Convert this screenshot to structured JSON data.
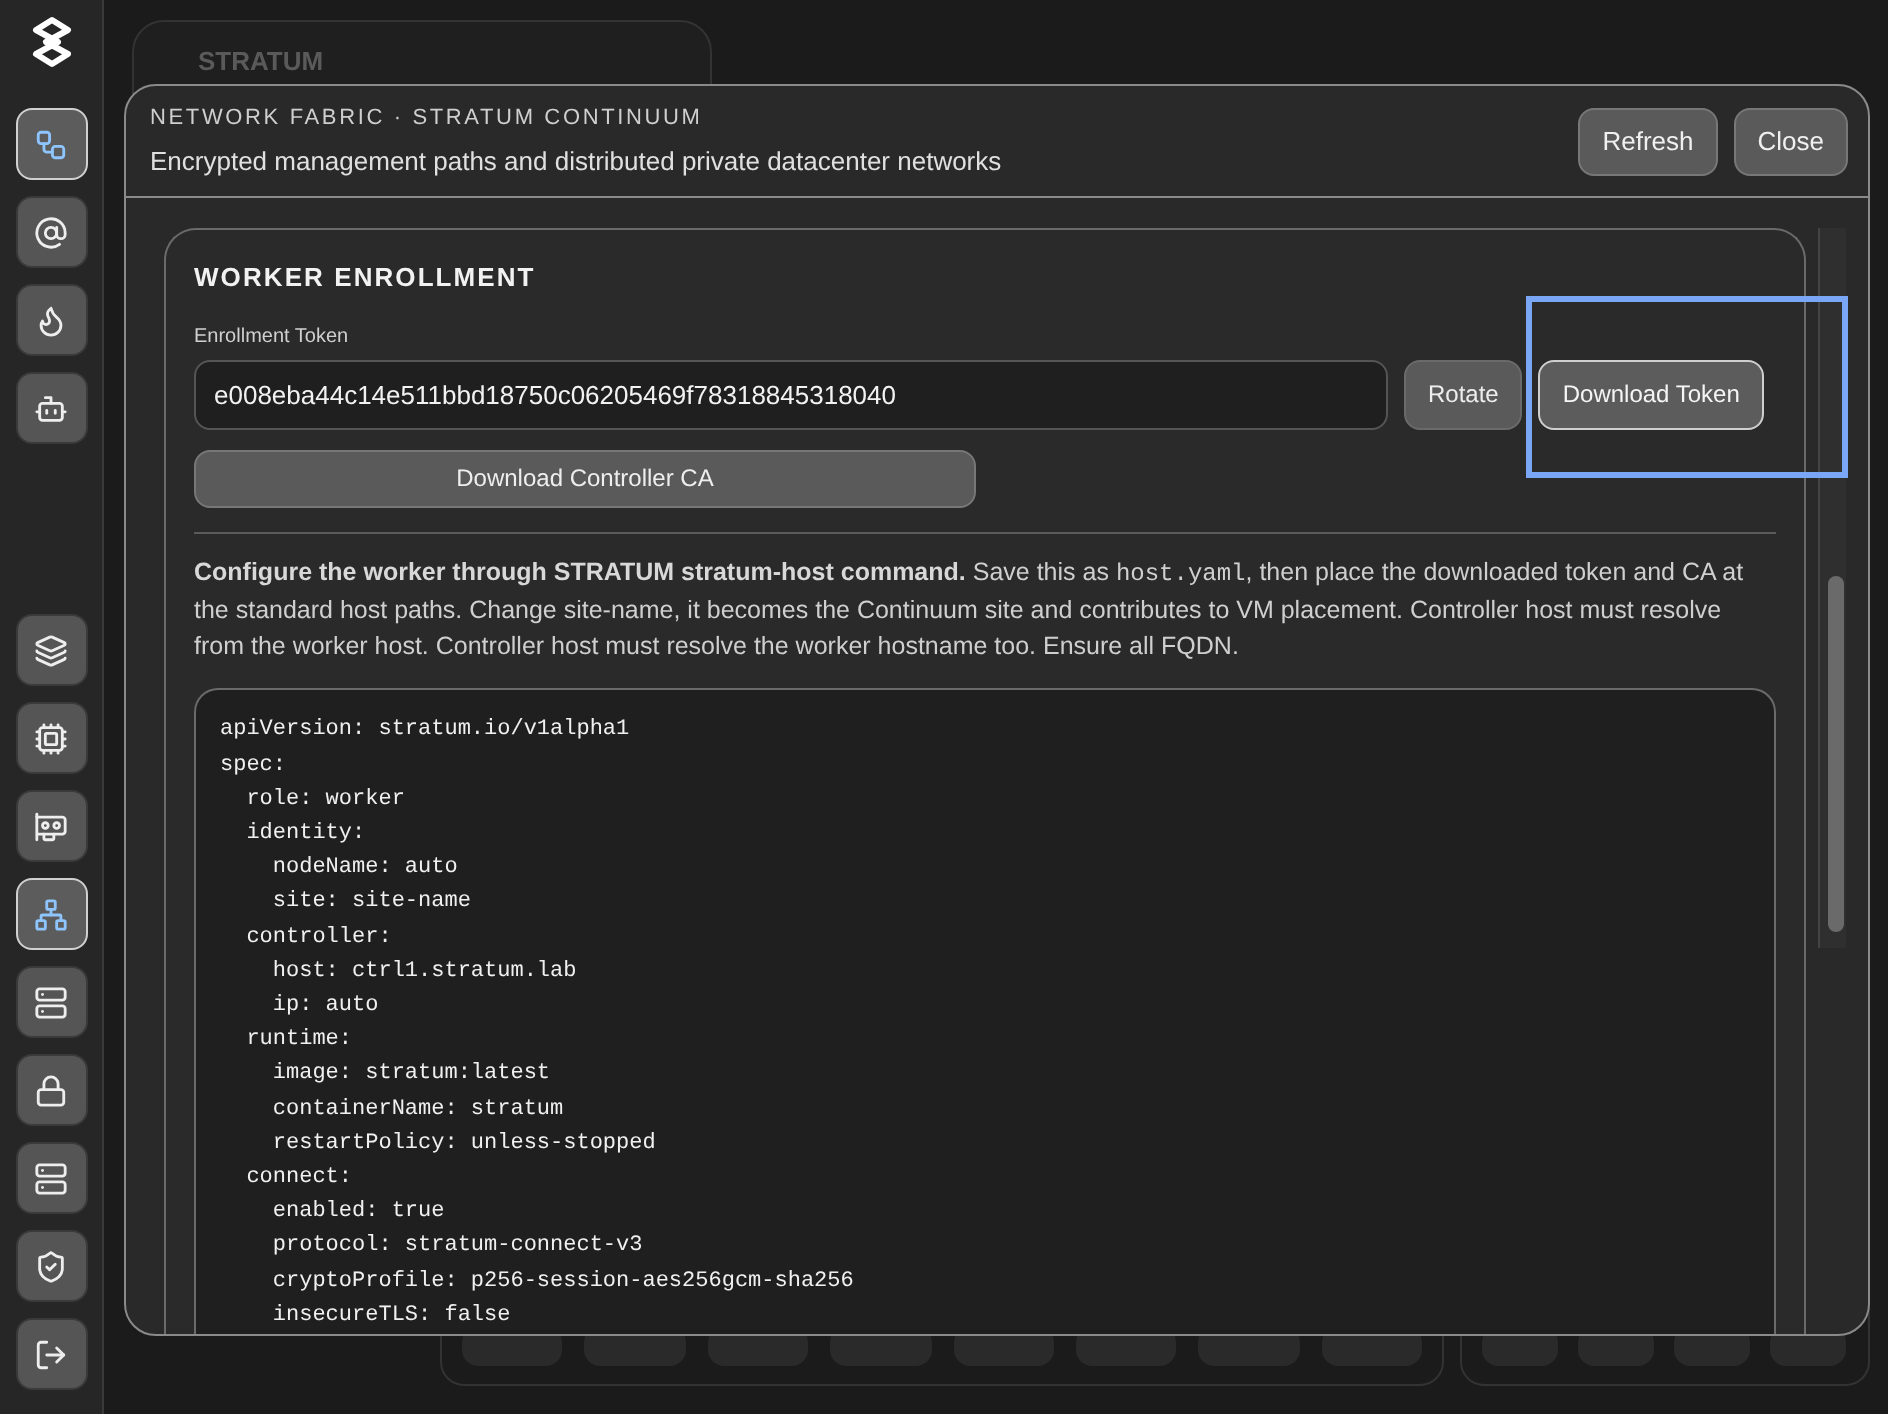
{
  "sidebar": {
    "top_items": [
      {
        "selected": true
      },
      {
        "selected": false
      },
      {
        "selected": false
      },
      {
        "selected": false
      }
    ],
    "bottom_items": [
      {
        "selected": false
      },
      {
        "selected": false
      },
      {
        "selected": false
      },
      {
        "selected": true
      },
      {
        "selected": false
      },
      {
        "selected": false
      },
      {
        "selected": false
      },
      {
        "selected": false
      },
      {
        "selected": false
      }
    ]
  },
  "background_card": {
    "title": "STRATUM"
  },
  "modal": {
    "eyebrow": "NETWORK FABRIC · STRATUM CONTINUUM",
    "subtitle": "Encrypted management paths and distributed private datacenter networks",
    "buttons": [
      "Refresh",
      "Close"
    ],
    "section": {
      "title": "WORKER ENROLLMENT",
      "token_label": "Enrollment Token",
      "token_value": "e008eba44c14e511bbd18750c06205469f78318845318040",
      "rotate_button": "Rotate",
      "download_token_button": "Download Token",
      "ca_button": "Download Controller CA",
      "description": [
        {
          "kind": "bold",
          "text": "Configure the worker through STRATUM stratum-host command."
        },
        {
          "kind": "plain",
          "text": " Save this as "
        },
        {
          "kind": "code",
          "text": "host.yaml"
        },
        {
          "kind": "plain",
          "text": ", then place the downloaded token and CA at the standard host paths. Change site-name, it becomes the Continuum site and contributes to VM placement. Controller host must resolve from the worker host. Controller host must resolve the worker hostname too. Ensure all FQDN."
        }
      ],
      "code_lines": [
        "apiVersion: stratum.io/v1alpha1",
        "spec:",
        "  role: worker",
        "  identity:",
        "    nodeName: auto",
        "    site: site-name",
        "  controller:",
        "    host: ctrl1.stratum.lab",
        "    ip: auto",
        "  runtime:",
        "    image: stratum:latest",
        "    containerName: stratum",
        "    restartPolicy: unless-stopped",
        "  connect:",
        "    enabled: true",
        "    protocol: stratum-connect-v3",
        "    cryptoProfile: p256-session-aes256gcm-sha256",
        "    insecureTLS: false"
      ]
    }
  }
}
